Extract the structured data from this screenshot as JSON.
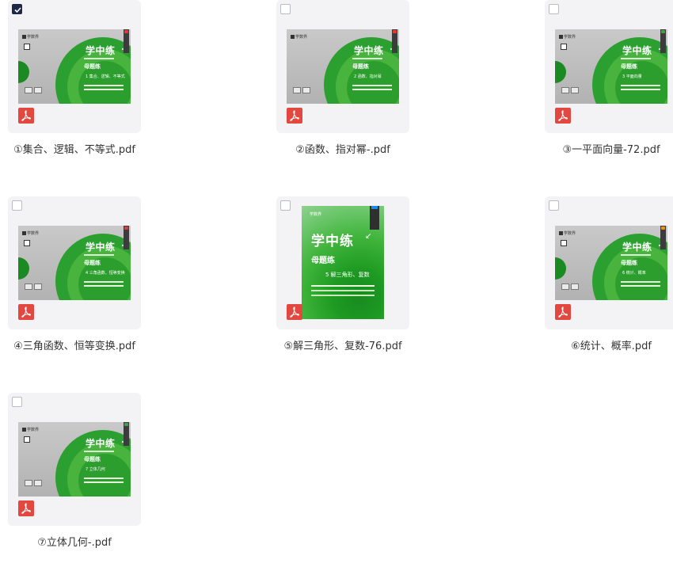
{
  "files": [
    {
      "name": "①集合、逻辑、不等式.pdf",
      "checked": true,
      "cover": {
        "brand": "学数界",
        "title": "学中练",
        "book": "母题练",
        "chapter": "1 集合、逻辑、不等式"
      }
    },
    {
      "name": "②函数、指对幂-.pdf",
      "checked": false,
      "cover": {
        "brand": "学数界",
        "title": "学中练",
        "book": "母题练",
        "chapter": "2 函数、指对幂"
      }
    },
    {
      "name": "③一平面向量-72.pdf",
      "checked": false,
      "cover": {
        "brand": "学数界",
        "title": "学中练",
        "book": "母题练",
        "chapter": "3 平面向量"
      }
    },
    {
      "name": "④三角函数、恒等变换.pdf",
      "checked": false,
      "cover": {
        "brand": "学数界",
        "title": "学中练",
        "book": "母题练",
        "chapter": "4 三角函数、恒等变换"
      }
    },
    {
      "name": "⑤解三角形、复数-76.pdf",
      "checked": false,
      "cover": {
        "brand": "学数界",
        "title": "学中练",
        "book": "母题练",
        "chapter": "5 解三角形、复数"
      }
    },
    {
      "name": "⑥统计、概率.pdf",
      "checked": false,
      "cover": {
        "brand": "学数界",
        "title": "学中练",
        "book": "母题练",
        "chapter": "6 统计、概率"
      }
    },
    {
      "name": "⑦立体几何-.pdf",
      "checked": false,
      "cover": {
        "brand": "学数界",
        "title": "学中练",
        "book": "母题练",
        "chapter": "7 立体几何"
      }
    }
  ],
  "colors": {
    "accent_check": "#1f2746",
    "pdf_icon": "#e24840",
    "card_bg": "#f3f3f5"
  },
  "icons": {
    "pdf": "pdf-icon",
    "check": "checkmark-icon"
  }
}
